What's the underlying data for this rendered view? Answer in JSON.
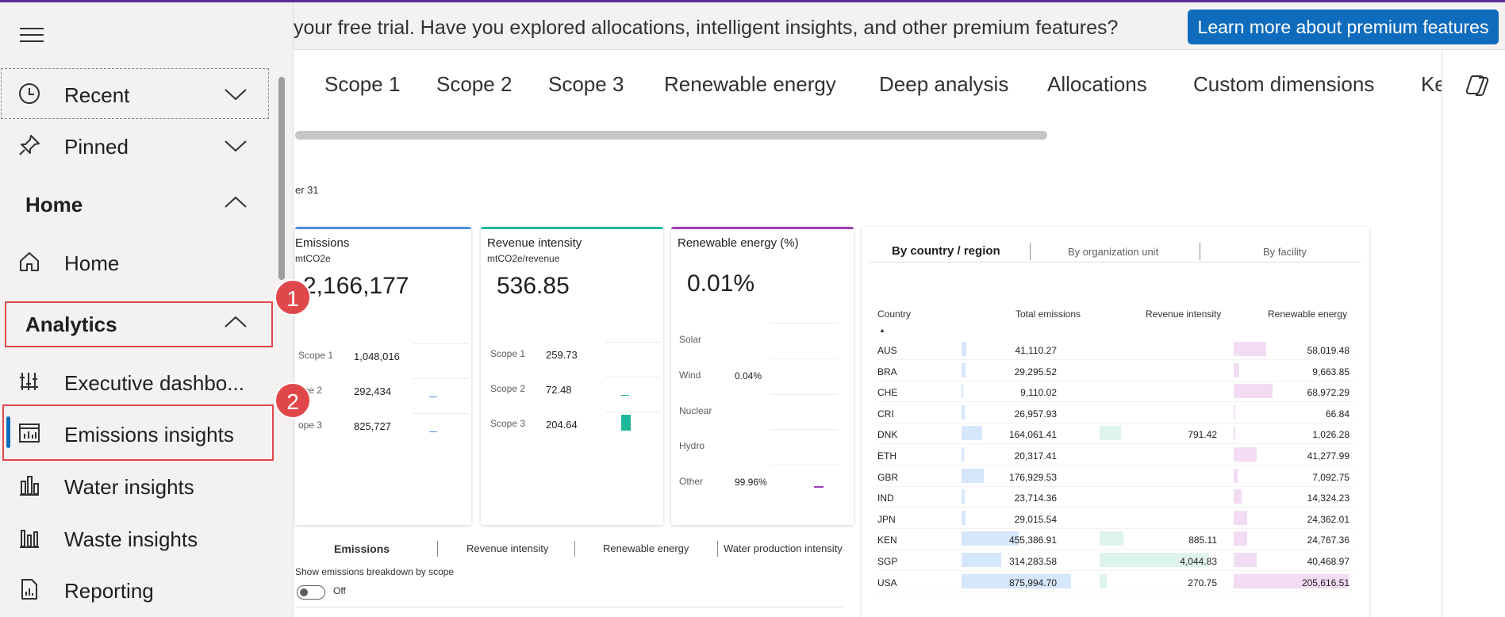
{
  "banner": {
    "text": "your free trial. Have you explored allocations, intelligent insights, and other premium features?",
    "button_label": "Learn more about premium features"
  },
  "tabs": [
    "Scope 1",
    "Scope 2",
    "Scope 3",
    "Renewable energy",
    "Deep analysis",
    "Allocations",
    "Custom dimensions",
    "Ke"
  ],
  "subtitle": "er 31",
  "cards": {
    "emissions": {
      "title": "Emissions",
      "unit": "mtCO2e",
      "value": "2,166,177",
      "accent": "#4f8fe0",
      "rows": [
        {
          "label": "Scope 1",
          "value": "1,048,016"
        },
        {
          "label": "ope 2",
          "value": "292,434"
        },
        {
          "label": "ope 3",
          "value": "825,727"
        }
      ]
    },
    "revenue": {
      "title": "Revenue intensity",
      "unit": "mtCO2e/revenue",
      "value": "536.85",
      "accent": "#1fb89a",
      "rows": [
        {
          "label": "Scope 1",
          "value": "259.73"
        },
        {
          "label": "Scope 2",
          "value": "72.48"
        },
        {
          "label": "Scope 3",
          "value": "204.64"
        }
      ]
    },
    "renewable": {
      "title": "Renewable energy (%)",
      "value": "0.01%",
      "accent": "#9b3fb5",
      "rows": [
        {
          "label": "Solar",
          "value": ""
        },
        {
          "label": "Wind",
          "value": "0.04%"
        },
        {
          "label": "Nuclear",
          "value": ""
        },
        {
          "label": "Hydro",
          "value": ""
        },
        {
          "label": "Other",
          "value": "99.96%"
        }
      ]
    }
  },
  "bottom_tabs": [
    "Emissions",
    "Revenue intensity",
    "Renewable energy",
    "Water production intensity"
  ],
  "toggle": {
    "label": "Show emissions breakdown by scope",
    "state": "Off"
  },
  "table": {
    "tabs": [
      "By country / region",
      "By organization unit",
      "By facility"
    ],
    "headers": [
      "Country",
      "Total emissions",
      "Revenue intensity",
      "Renewable energy"
    ],
    "sort_arrow": "▲",
    "rows": [
      {
        "country": "AUS",
        "total": "41,110.27",
        "total_v": 41110.27,
        "rev": "",
        "rev_v": 0,
        "ren": "58,019.48",
        "ren_v": 58019.48
      },
      {
        "country": "BRA",
        "total": "29,295.52",
        "total_v": 29295.52,
        "rev": "",
        "rev_v": 0,
        "ren": "9,663.85",
        "ren_v": 9663.85
      },
      {
        "country": "CHE",
        "total": "9,110.02",
        "total_v": 9110.02,
        "rev": "",
        "rev_v": 0,
        "ren": "68,972.29",
        "ren_v": 68972.29
      },
      {
        "country": "CRI",
        "total": "26,957.93",
        "total_v": 26957.93,
        "rev": "",
        "rev_v": 0,
        "ren": "66.84",
        "ren_v": 66.84
      },
      {
        "country": "DNK",
        "total": "164,061.41",
        "total_v": 164061.41,
        "rev": "791.42",
        "rev_v": 791.42,
        "ren": "1,026.28",
        "ren_v": 1026.28
      },
      {
        "country": "ETH",
        "total": "20,317.41",
        "total_v": 20317.41,
        "rev": "",
        "rev_v": 0,
        "ren": "41,277.99",
        "ren_v": 41277.99
      },
      {
        "country": "GBR",
        "total": "176,929.53",
        "total_v": 176929.53,
        "rev": "",
        "rev_v": 0,
        "ren": "7,092.75",
        "ren_v": 7092.75
      },
      {
        "country": "IND",
        "total": "23,714.36",
        "total_v": 23714.36,
        "rev": "",
        "rev_v": 0,
        "ren": "14,324.23",
        "ren_v": 14324.23
      },
      {
        "country": "JPN",
        "total": "29,015.54",
        "total_v": 29015.54,
        "rev": "",
        "rev_v": 0,
        "ren": "24,362.01",
        "ren_v": 24362.01
      },
      {
        "country": "KEN",
        "total": "455,386.91",
        "total_v": 455386.91,
        "rev": "885.11",
        "rev_v": 885.11,
        "ren": "24,767.36",
        "ren_v": 24767.36
      },
      {
        "country": "SGP",
        "total": "314,283.58",
        "total_v": 314283.58,
        "rev": "4,044.83",
        "rev_v": 4044.83,
        "ren": "40,468.97",
        "ren_v": 40468.97
      },
      {
        "country": "USA",
        "total": "875,994.70",
        "total_v": 875994.7,
        "rev": "270.75",
        "rev_v": 270.75,
        "ren": "205,616.51",
        "ren_v": 205616.51
      }
    ]
  },
  "sidebar": {
    "recent": "Recent",
    "pinned": "Pinned",
    "home_group": "Home",
    "home": "Home",
    "analytics_group": "Analytics",
    "items": [
      "Executive dashbo...",
      "Emissions insights",
      "Water insights",
      "Waste insights",
      "Reporting"
    ]
  },
  "callouts": [
    "1",
    "2"
  ],
  "colors": {
    "accent": "#0f6cbd",
    "highlight": "#e0474b",
    "emissions_bar": "#4f8fe0",
    "revenue_bar": "#1fb89a",
    "renewable_bar": "#9b3fb5"
  }
}
